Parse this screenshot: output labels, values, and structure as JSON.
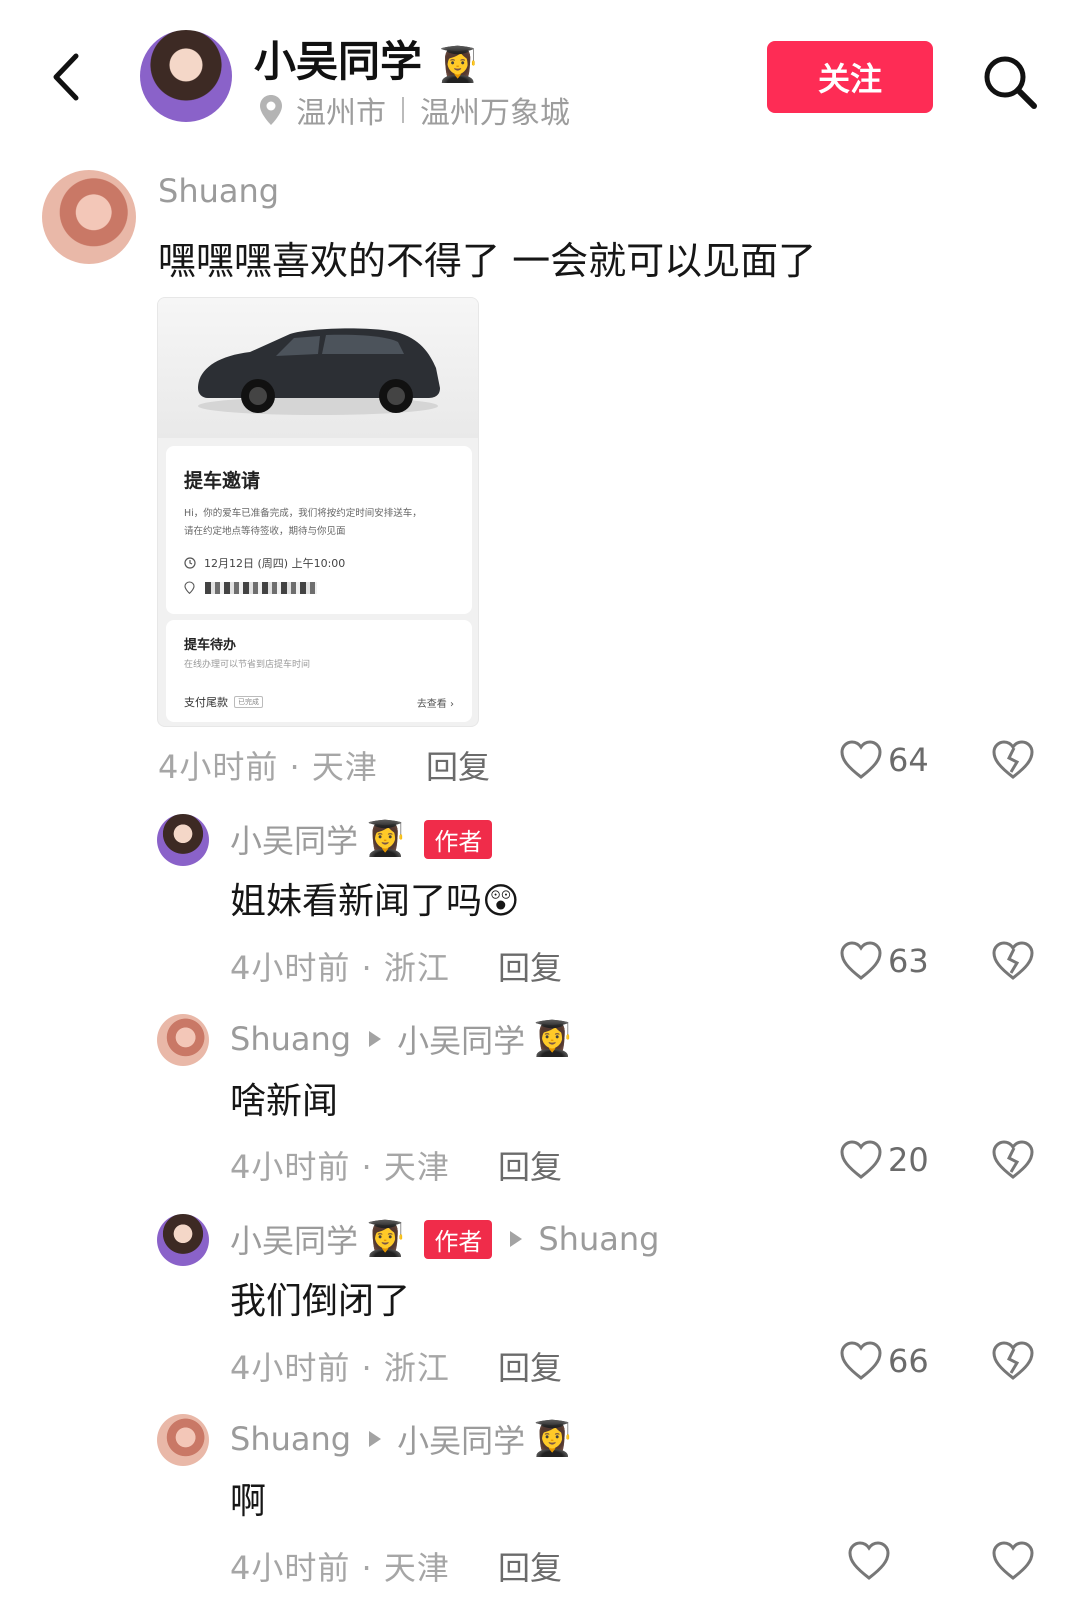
{
  "header": {
    "title": "小吴同学",
    "title_emoji": "👩‍🎓",
    "location_city": "温州市",
    "location_place": "温州万象城",
    "follow_label": "关注",
    "accent_color": "#fe2c55"
  },
  "top_comment": {
    "user": "Shuang",
    "text": "嘿嘿嘿喜欢的不得了 一会就可以见面了",
    "image_card": {
      "title": "提车邀请",
      "body_line1": "Hi，你的爱车已准备完成，我们将按约定时间安排送车，",
      "body_line2": "请在约定地点等待签收，期待与你见面",
      "time": "12月12日 (周四) 上午10:00",
      "todo_title": "提车待办",
      "todo_sub": "在线办理可以节省到店提车时间",
      "pay_label": "支付尾款",
      "pay_status": "已完成",
      "view_label": "去查看 ›"
    },
    "meta": "4小时前 · 天津",
    "reply": "回复",
    "likes": "64"
  },
  "replies": [
    {
      "user": "小吴同学",
      "emoji": "👩‍🎓",
      "badge": "作者",
      "to": "",
      "to_emoji": "",
      "text": "姐妹看新闻了吗",
      "text_emoji": "😲",
      "meta": "4小时前 · 浙江",
      "reply": "回复",
      "likes": "63"
    },
    {
      "user": "Shuang",
      "emoji": "",
      "badge": "",
      "to": "小吴同学",
      "to_emoji": "👩‍🎓",
      "text": "啥新闻",
      "text_emoji": "",
      "meta": "4小时前 · 天津",
      "reply": "回复",
      "likes": "20"
    },
    {
      "user": "小吴同学",
      "emoji": "👩‍🎓",
      "badge": "作者",
      "to": "Shuang",
      "to_emoji": "",
      "text": "我们倒闭了",
      "text_emoji": "",
      "meta": "4小时前 · 浙江",
      "reply": "回复",
      "likes": "66"
    },
    {
      "user": "Shuang",
      "emoji": "",
      "badge": "",
      "to": "小吴同学",
      "to_emoji": "👩‍🎓",
      "text": "啊",
      "text_emoji": "",
      "meta": "4小时前 · 天津",
      "reply": "回复",
      "likes": ""
    }
  ]
}
